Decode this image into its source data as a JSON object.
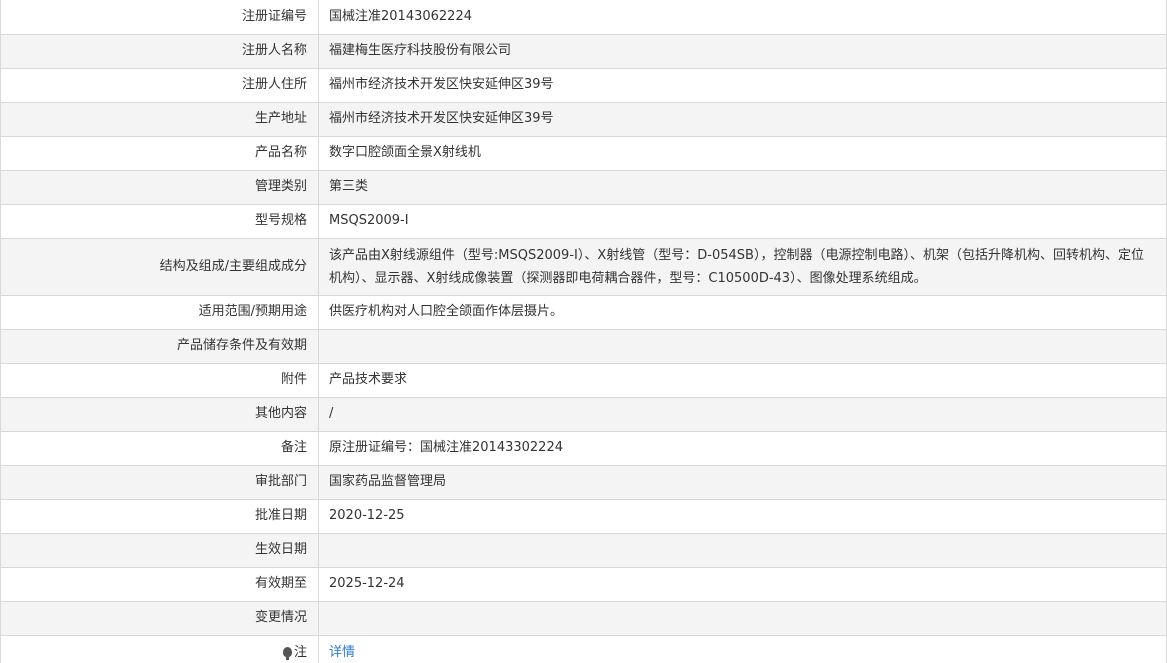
{
  "rows": [
    {
      "label": "注册证编号",
      "value": "国械注准20143062224"
    },
    {
      "label": "注册人名称",
      "value": "福建梅生医疗科技股份有限公司"
    },
    {
      "label": "注册人住所",
      "value": "福州市经济技术开发区快安延伸区39号"
    },
    {
      "label": "生产地址",
      "value": "福州市经济技术开发区快安延伸区39号"
    },
    {
      "label": "产品名称",
      "value": "数字口腔颌面全景X射线机"
    },
    {
      "label": "管理类别",
      "value": "第三类"
    },
    {
      "label": "型号规格",
      "value": "MSQS2009-Ⅰ"
    },
    {
      "label": "结构及组成/主要组成成分",
      "value": "该产品由X射线源组件（型号:MSQS2009-Ⅰ）、X射线管（型号：D-054SB），控制器（电源控制电路）、机架（包括升降机构、回转机构、定位机构）、显示器、X射线成像装置（探测器即电荷耦合器件，型号：C10500D-43）、图像处理系统组成。"
    },
    {
      "label": "适用范围/预期用途",
      "value": "供医疗机构对人口腔全颌面作体层摄片。"
    },
    {
      "label": "产品储存条件及有效期",
      "value": ""
    },
    {
      "label": "附件",
      "value": "产品技术要求"
    },
    {
      "label": "其他内容",
      "value": "/"
    },
    {
      "label": "备注",
      "value": "原注册证编号：国械注准20143302224"
    },
    {
      "label": "审批部门",
      "value": "国家药品监督管理局"
    },
    {
      "label": "批准日期",
      "value": "2020-12-25"
    },
    {
      "label": "生效日期",
      "value": ""
    },
    {
      "label": "有效期至",
      "value": "2025-12-24"
    },
    {
      "label": "变更情况",
      "value": ""
    }
  ],
  "note_row": {
    "icon": "lightbulb-icon",
    "label": "注",
    "link_text": "详情"
  }
}
